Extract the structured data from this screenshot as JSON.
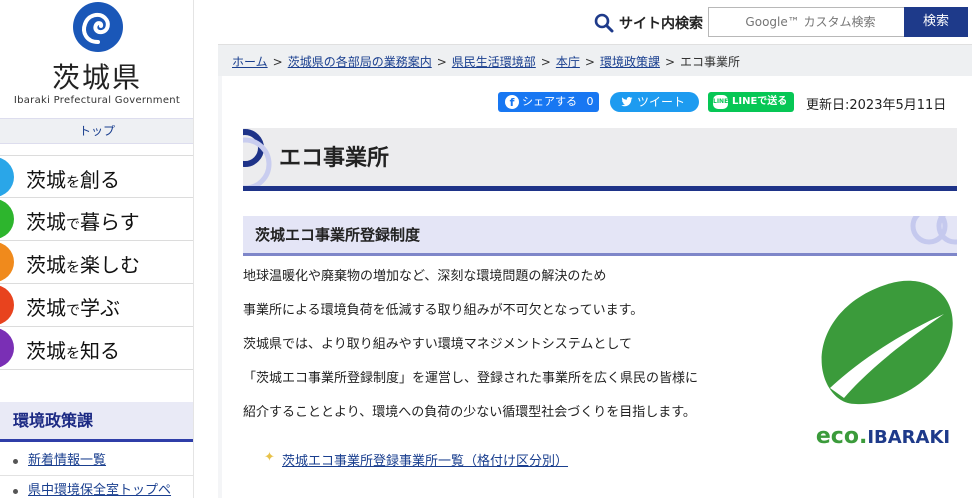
{
  "header": {
    "logo_jp": "茨城県",
    "logo_en": "Ibaraki Prefectural Government",
    "search_title": "サイト内検索",
    "search_placeholder": "Google™ カスタム検索",
    "search_button": "検索"
  },
  "sidebar": {
    "top_link": "トップ",
    "nav_items": [
      {
        "main1": "茨城",
        "small": "を",
        "main2": "創る",
        "color": "#2aa6e8"
      },
      {
        "main1": "茨城",
        "small": "で",
        "main2": "暮らす",
        "color": "#2db52d"
      },
      {
        "main1": "茨城",
        "small": "を",
        "main2": "楽しむ",
        "color": "#f08a1c"
      },
      {
        "main1": "茨城",
        "small": "で",
        "main2": "学ぶ",
        "color": "#e8431e"
      },
      {
        "main1": "茨城",
        "small": "を",
        "main2": "知る",
        "color": "#7a2fb5"
      }
    ],
    "dept_heading": "環境政策課",
    "links": [
      "新着情報一覧",
      "県中環境保全室トップペ"
    ]
  },
  "breadcrumb": {
    "items": [
      "ホーム",
      "茨城県の各部局の業務案内",
      "県民生活環境部",
      "本庁",
      "環境政策課"
    ],
    "current": "エコ事業所"
  },
  "share": {
    "facebook": "シェアする",
    "facebook_count": "0",
    "twitter": "ツイート",
    "line": "LINEで送る",
    "updated": "更新日:2023年5月11日"
  },
  "page": {
    "title": "エコ事業所",
    "section_title": "茨城エコ事業所登録制度",
    "paragraphs": [
      "地球温暖化や廃棄物の増加など、深刻な環境問題の解決のため",
      "事業所による環境負荷を低減する取り組みが不可欠となっています。",
      "茨城県では、より取り組みやすい環境マネジメントシステムとして",
      "「茨城エコ事業所登録制度」を運営し、登録された事業所を広く県民の皆様に",
      "紹介することとより、環境への負荷の少ない循環型社会づくりを目指します。"
    ],
    "link": "茨城エコ事業所登録事業所一覧（格付け区分別）",
    "eco_logo_a": "eco.",
    "eco_logo_b": "IBARAKI"
  },
  "colors": {
    "brand_blue": "#1e3a8a",
    "eco_green": "#3b9b3b"
  }
}
